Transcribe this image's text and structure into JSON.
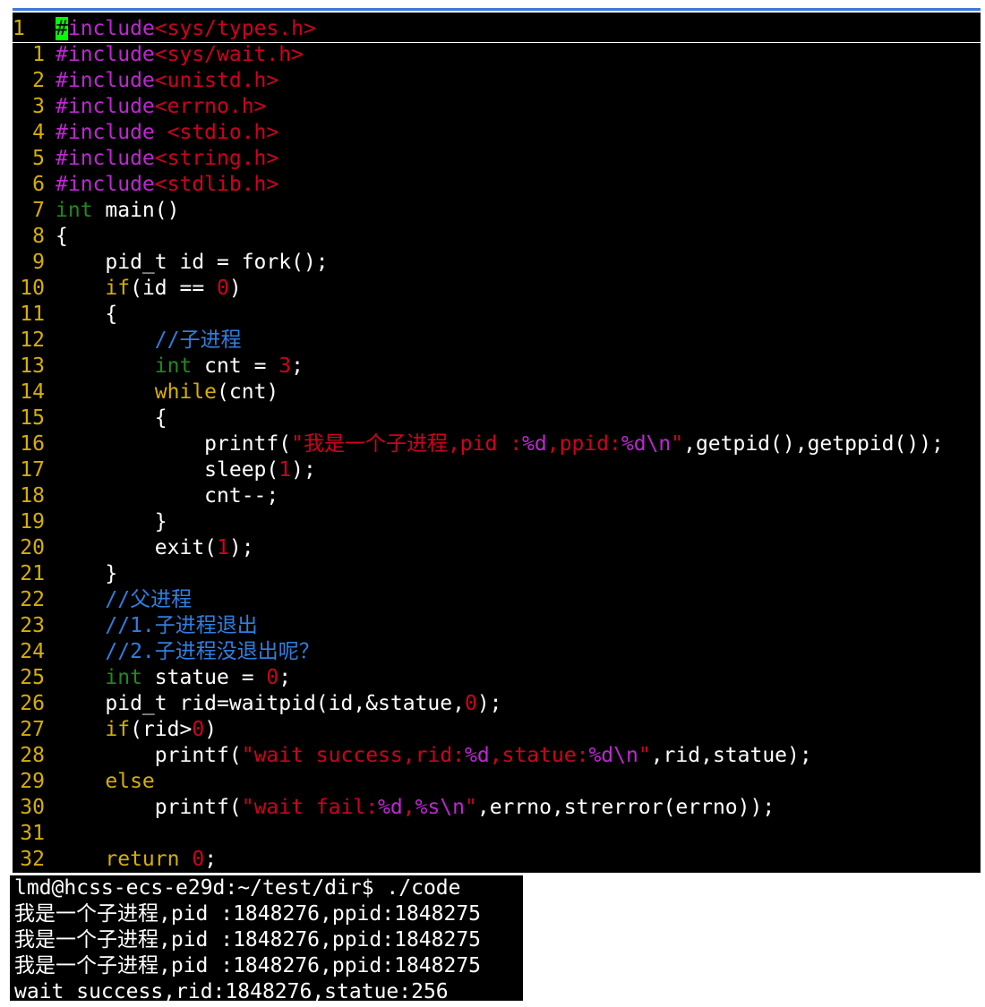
{
  "colors": {
    "editor_bg": "#000000",
    "line_number": "#d7af00",
    "preprocessor": "#c026d3",
    "string": "#d0001f",
    "number": "#d0001f",
    "keyword": "#d7af00",
    "type": "#1f8a1f",
    "comment": "#2f7fe0",
    "cursor": "#00ff00",
    "text": "#ffffff"
  },
  "editor": {
    "lines": [
      {
        "num": "1",
        "tokens": [
          {
            "t": "#",
            "c": "cursor"
          },
          {
            "t": "include",
            "c": "pp"
          },
          {
            "t": "<sys/types.h>",
            "c": "str"
          }
        ]
      },
      {
        "num": "1",
        "tokens": [
          {
            "t": "#include",
            "c": "pp"
          },
          {
            "t": "<sys/wait.h>",
            "c": "str"
          }
        ]
      },
      {
        "num": "2",
        "tokens": [
          {
            "t": "#include",
            "c": "pp"
          },
          {
            "t": "<unistd.h>",
            "c": "str"
          }
        ]
      },
      {
        "num": "3",
        "tokens": [
          {
            "t": "#include",
            "c": "pp"
          },
          {
            "t": "<errno.h>",
            "c": "str"
          }
        ]
      },
      {
        "num": "4",
        "tokens": [
          {
            "t": "#include ",
            "c": "pp"
          },
          {
            "t": "<stdio.h>",
            "c": "str"
          }
        ]
      },
      {
        "num": "5",
        "tokens": [
          {
            "t": "#include",
            "c": "pp"
          },
          {
            "t": "<string.h>",
            "c": "str"
          }
        ]
      },
      {
        "num": "6",
        "tokens": [
          {
            "t": "#include",
            "c": "pp"
          },
          {
            "t": "<stdlib.h>",
            "c": "str"
          }
        ]
      },
      {
        "num": "7",
        "tokens": [
          {
            "t": "int",
            "c": "type"
          },
          {
            "t": " main()",
            "c": "plain"
          }
        ]
      },
      {
        "num": "8",
        "tokens": [
          {
            "t": "{",
            "c": "plain"
          }
        ]
      },
      {
        "num": "9",
        "tokens": [
          {
            "t": "    pid_t id = fork();",
            "c": "plain"
          }
        ]
      },
      {
        "num": "10",
        "tokens": [
          {
            "t": "    ",
            "c": "plain"
          },
          {
            "t": "if",
            "c": "kw"
          },
          {
            "t": "(id == ",
            "c": "plain"
          },
          {
            "t": "0",
            "c": "num"
          },
          {
            "t": ")",
            "c": "plain"
          }
        ]
      },
      {
        "num": "11",
        "tokens": [
          {
            "t": "    {",
            "c": "plain"
          }
        ]
      },
      {
        "num": "12",
        "tokens": [
          {
            "t": "        ",
            "c": "plain"
          },
          {
            "t": "//子进程",
            "c": "comment"
          }
        ]
      },
      {
        "num": "13",
        "tokens": [
          {
            "t": "        ",
            "c": "plain"
          },
          {
            "t": "int",
            "c": "type"
          },
          {
            "t": " cnt = ",
            "c": "plain"
          },
          {
            "t": "3",
            "c": "num"
          },
          {
            "t": ";",
            "c": "plain"
          }
        ]
      },
      {
        "num": "14",
        "tokens": [
          {
            "t": "        ",
            "c": "plain"
          },
          {
            "t": "while",
            "c": "kw"
          },
          {
            "t": "(cnt)",
            "c": "plain"
          }
        ]
      },
      {
        "num": "15",
        "tokens": [
          {
            "t": "        {",
            "c": "plain"
          }
        ]
      },
      {
        "num": "16",
        "tokens": [
          {
            "t": "            printf(",
            "c": "plain"
          },
          {
            "t": "\"我是一个子进程,pid :",
            "c": "str"
          },
          {
            "t": "%d",
            "c": "fmt"
          },
          {
            "t": ",ppid:",
            "c": "str"
          },
          {
            "t": "%d\\n",
            "c": "fmt"
          },
          {
            "t": "\"",
            "c": "str"
          },
          {
            "t": ",getpid(),getppid());",
            "c": "plain"
          }
        ]
      },
      {
        "num": "17",
        "tokens": [
          {
            "t": "            sleep(",
            "c": "plain"
          },
          {
            "t": "1",
            "c": "num"
          },
          {
            "t": ");",
            "c": "plain"
          }
        ]
      },
      {
        "num": "18",
        "tokens": [
          {
            "t": "            cnt--;",
            "c": "plain"
          }
        ]
      },
      {
        "num": "19",
        "tokens": [
          {
            "t": "        }",
            "c": "plain"
          }
        ]
      },
      {
        "num": "20",
        "tokens": [
          {
            "t": "        exit(",
            "c": "plain"
          },
          {
            "t": "1",
            "c": "num"
          },
          {
            "t": ");",
            "c": "plain"
          }
        ]
      },
      {
        "num": "21",
        "tokens": [
          {
            "t": "    }",
            "c": "plain"
          }
        ]
      },
      {
        "num": "22",
        "tokens": [
          {
            "t": "    ",
            "c": "plain"
          },
          {
            "t": "//父进程",
            "c": "comment"
          }
        ]
      },
      {
        "num": "23",
        "tokens": [
          {
            "t": "    ",
            "c": "plain"
          },
          {
            "t": "//1.子进程退出",
            "c": "comment"
          }
        ]
      },
      {
        "num": "24",
        "tokens": [
          {
            "t": "    ",
            "c": "plain"
          },
          {
            "t": "//2.子进程没退出呢？",
            "c": "comment"
          }
        ]
      },
      {
        "num": "25",
        "tokens": [
          {
            "t": "    ",
            "c": "plain"
          },
          {
            "t": "int",
            "c": "type"
          },
          {
            "t": " statue = ",
            "c": "plain"
          },
          {
            "t": "0",
            "c": "num"
          },
          {
            "t": ";",
            "c": "plain"
          }
        ]
      },
      {
        "num": "26",
        "tokens": [
          {
            "t": "    pid_t rid=waitpid(id,&statue,",
            "c": "plain"
          },
          {
            "t": "0",
            "c": "num"
          },
          {
            "t": ");",
            "c": "plain"
          }
        ]
      },
      {
        "num": "27",
        "tokens": [
          {
            "t": "    ",
            "c": "plain"
          },
          {
            "t": "if",
            "c": "kw"
          },
          {
            "t": "(rid>",
            "c": "plain"
          },
          {
            "t": "0",
            "c": "num"
          },
          {
            "t": ")",
            "c": "plain"
          }
        ]
      },
      {
        "num": "28",
        "tokens": [
          {
            "t": "        printf(",
            "c": "plain"
          },
          {
            "t": "\"wait success,rid:",
            "c": "str"
          },
          {
            "t": "%d",
            "c": "fmt"
          },
          {
            "t": ",statue:",
            "c": "str"
          },
          {
            "t": "%d\\n",
            "c": "fmt"
          },
          {
            "t": "\"",
            "c": "str"
          },
          {
            "t": ",rid,statue);",
            "c": "plain"
          }
        ]
      },
      {
        "num": "29",
        "tokens": [
          {
            "t": "    ",
            "c": "plain"
          },
          {
            "t": "else",
            "c": "kw"
          }
        ]
      },
      {
        "num": "30",
        "tokens": [
          {
            "t": "        printf(",
            "c": "plain"
          },
          {
            "t": "\"wait fail:",
            "c": "str"
          },
          {
            "t": "%d",
            "c": "fmt"
          },
          {
            "t": ",",
            "c": "str"
          },
          {
            "t": "%s\\n",
            "c": "fmt"
          },
          {
            "t": "\"",
            "c": "str"
          },
          {
            "t": ",errno,strerror(errno));",
            "c": "plain"
          }
        ]
      },
      {
        "num": "31",
        "tokens": [
          {
            "t": "",
            "c": "plain"
          }
        ]
      },
      {
        "num": "32",
        "tokens": [
          {
            "t": "    ",
            "c": "plain"
          },
          {
            "t": "return",
            "c": "kw"
          },
          {
            "t": " ",
            "c": "plain"
          },
          {
            "t": "0",
            "c": "num"
          },
          {
            "t": ";",
            "c": "plain"
          }
        ]
      }
    ]
  },
  "terminal": {
    "lines": [
      "lmd@hcss-ecs-e29d:~/test/dir$ ./code",
      "我是一个子进程,pid :1848276,ppid:1848275",
      "我是一个子进程,pid :1848276,ppid:1848275",
      "我是一个子进程,pid :1848276,ppid:1848275",
      "wait success,rid:1848276,statue:256"
    ]
  }
}
